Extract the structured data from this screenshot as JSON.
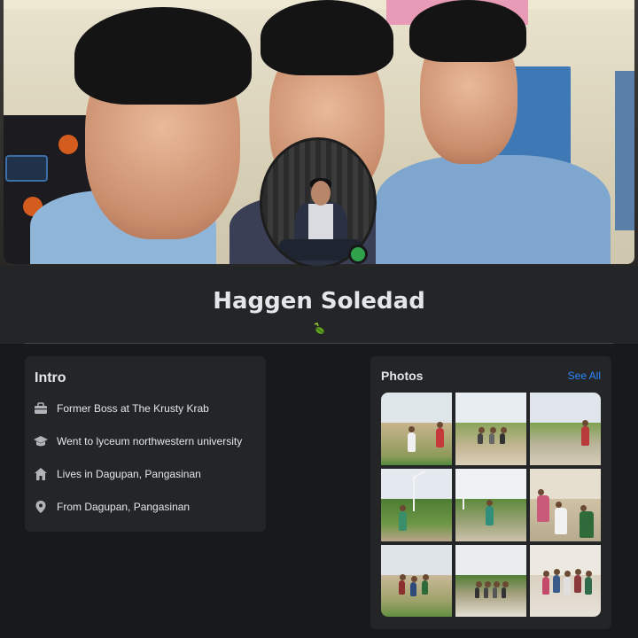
{
  "profile": {
    "name": "Haggen Soledad",
    "online": true
  },
  "intro": {
    "title": "Intro",
    "items": [
      {
        "icon": "briefcase-icon",
        "text": "Former Boss at The Krusty Krab"
      },
      {
        "icon": "graduation-cap-icon",
        "text": "Went to lyceum northwestern university"
      },
      {
        "icon": "home-icon",
        "text": "Lives in Dagupan, Pangasinan"
      },
      {
        "icon": "location-pin-icon",
        "text": "From Dagupan, Pangasinan"
      }
    ]
  },
  "photos": {
    "title": "Photos",
    "see_all": "See All",
    "count": 9
  },
  "colors": {
    "background": "#18191a",
    "card": "#242526",
    "link": "#2d88ff",
    "online": "#31a24c",
    "text": "#e4e6eb"
  }
}
